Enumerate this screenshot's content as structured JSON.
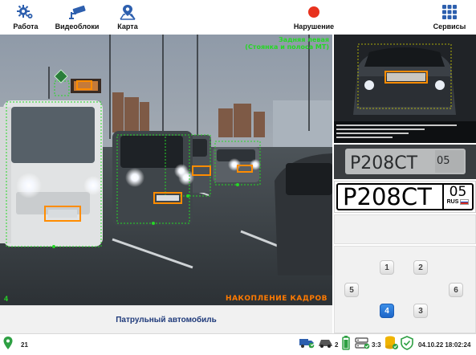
{
  "toolbar": {
    "work_label": "Работа",
    "videoblocks_label": "Видеоблоки",
    "map_label": "Карта",
    "violation_label": "Нарушение",
    "services_label": "Сервисы"
  },
  "camera": {
    "zone_title_line1": "Задняя левая",
    "zone_title_line2": "(Стоянка и полоса МТ)",
    "status_text": "НАКОПЛЕНИЕ КАДРОВ",
    "camera_index": "4"
  },
  "vehicle_type": "Патрульный автомобиль",
  "plate": {
    "main": "Р208СТ",
    "region": "05",
    "country": "RUS",
    "crop_text": "Р208СТ",
    "crop_region": "05"
  },
  "camera_selector": {
    "buttons": [
      {
        "label": "1",
        "active": false
      },
      {
        "label": "2",
        "active": false
      },
      {
        "label": "5",
        "active": false
      },
      {
        "label": "6",
        "active": false
      },
      {
        "label": "4",
        "active": true
      },
      {
        "label": "3",
        "active": false
      }
    ]
  },
  "statusbar": {
    "location_count": "21",
    "vehicle_count": "2",
    "server_ratio": "3:3",
    "datetime": "04.10.22 18:02:24"
  },
  "colors": {
    "accent_blue": "#1e66c8",
    "detection_green": "#25d825",
    "plate_orange": "#ff8c00",
    "violation_red": "#e8321e",
    "status_green": "#2ea043"
  }
}
